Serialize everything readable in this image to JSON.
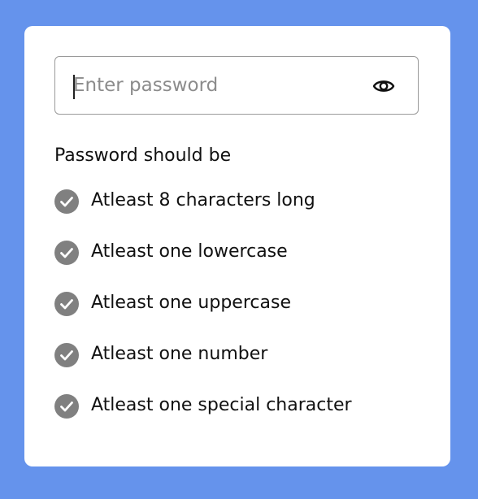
{
  "password_field": {
    "value": "",
    "placeholder": "Enter password",
    "toggle_icon": "eye-icon"
  },
  "requirements": {
    "heading": "Password should be",
    "icon": "check-circle-icon",
    "icon_color": "#808080",
    "items": [
      {
        "label": "Atleast 8 characters long"
      },
      {
        "label": "Atleast one lowercase"
      },
      {
        "label": "Atleast one uppercase"
      },
      {
        "label": "Atleast one number"
      },
      {
        "label": "Atleast one special character"
      }
    ]
  },
  "colors": {
    "background": "#6593ec",
    "card": "#ffffff",
    "text": "#111111"
  }
}
